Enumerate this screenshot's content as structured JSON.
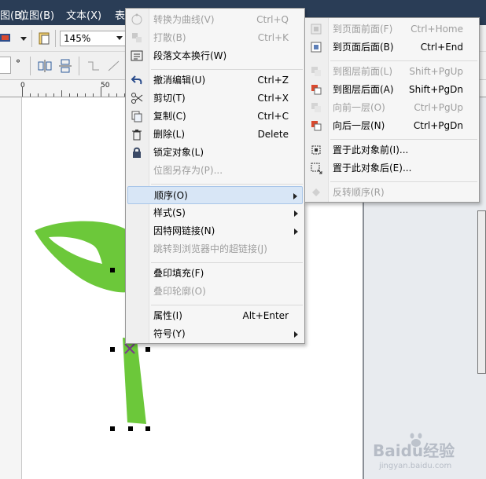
{
  "menubar": {
    "items": [
      {
        "label": "图(B)"
      },
      {
        "label": "位图(B)"
      },
      {
        "label": "文本(X)"
      },
      {
        "label": "表"
      }
    ]
  },
  "toolbar": {
    "zoom_value": "145%"
  },
  "ruler": {
    "labels": [
      "0",
      "50"
    ]
  },
  "context_menu": {
    "items": [
      {
        "label": "转换为曲线(V)",
        "shortcut": "Ctrl+Q",
        "icon": "convert-curve-icon",
        "enabled": false
      },
      {
        "label": "打散(B)",
        "shortcut": "Ctrl+K",
        "icon": "break-apart-icon",
        "enabled": false
      },
      {
        "label": "段落文本换行(W)",
        "shortcut": "",
        "icon": "text-wrap-icon",
        "enabled": true
      },
      {
        "label": "撤消编辑(U)",
        "shortcut": "Ctrl+Z",
        "icon": "undo-icon",
        "enabled": true
      },
      {
        "label": "剪切(T)",
        "shortcut": "Ctrl+X",
        "icon": "cut-icon",
        "enabled": true
      },
      {
        "label": "复制(C)",
        "shortcut": "Ctrl+C",
        "icon": "copy-icon",
        "enabled": true
      },
      {
        "label": "删除(L)",
        "shortcut": "Delete",
        "icon": "delete-icon",
        "enabled": true
      },
      {
        "label": "锁定对象(L)",
        "shortcut": "",
        "icon": "lock-icon",
        "enabled": true
      },
      {
        "label": "位图另存为(P)...",
        "shortcut": "",
        "icon": "",
        "enabled": false
      },
      {
        "label": "顺序(O)",
        "shortcut": "",
        "icon": "",
        "enabled": true,
        "submenu": true,
        "highlighted": true
      },
      {
        "label": "样式(S)",
        "shortcut": "",
        "icon": "",
        "enabled": true,
        "submenu": true
      },
      {
        "label": "因特网链接(N)",
        "shortcut": "",
        "icon": "",
        "enabled": true,
        "submenu": true
      },
      {
        "label": "跳转到浏览器中的超链接(J)",
        "shortcut": "",
        "icon": "",
        "enabled": false
      },
      {
        "label": "叠印填充(F)",
        "shortcut": "",
        "icon": "",
        "enabled": true
      },
      {
        "label": "叠印轮廓(O)",
        "shortcut": "",
        "icon": "",
        "enabled": false
      },
      {
        "label": "属性(I)",
        "shortcut": "Alt+Enter",
        "icon": "",
        "enabled": true
      },
      {
        "label": "符号(Y)",
        "shortcut": "",
        "icon": "",
        "enabled": true,
        "submenu": true
      }
    ]
  },
  "order_submenu": {
    "items": [
      {
        "label": "到页面前面(F)",
        "shortcut": "Ctrl+Home",
        "icon": "to-page-front-icon",
        "enabled": false
      },
      {
        "label": "到页面后面(B)",
        "shortcut": "Ctrl+End",
        "icon": "to-page-back-icon",
        "enabled": true
      },
      {
        "label": "到图层前面(L)",
        "shortcut": "Shift+PgUp",
        "icon": "to-layer-front-icon",
        "enabled": false
      },
      {
        "label": "到图层后面(A)",
        "shortcut": "Shift+PgDn",
        "icon": "to-layer-back-icon",
        "enabled": true
      },
      {
        "label": "向前一层(O)",
        "shortcut": "Ctrl+PgUp",
        "icon": "forward-one-icon",
        "enabled": false
      },
      {
        "label": "向后一层(N)",
        "shortcut": "Ctrl+PgDn",
        "icon": "back-one-icon",
        "enabled": true
      },
      {
        "label": "置于此对象前(I)...",
        "shortcut": "",
        "icon": "in-front-of-icon",
        "enabled": true
      },
      {
        "label": "置于此对象后(E)...",
        "shortcut": "",
        "icon": "behind-icon",
        "enabled": true
      },
      {
        "label": "反转顺序(R)",
        "shortcut": "",
        "icon": "reverse-order-icon",
        "enabled": false
      }
    ]
  },
  "watermark": {
    "brand": "Baidu经验",
    "url": "jingyan.baidu.com"
  },
  "colors": {
    "leaf_green": "#6cc83a",
    "menubar_bg": "#2a3d56",
    "menu_highlight": "#d8e6f6"
  }
}
